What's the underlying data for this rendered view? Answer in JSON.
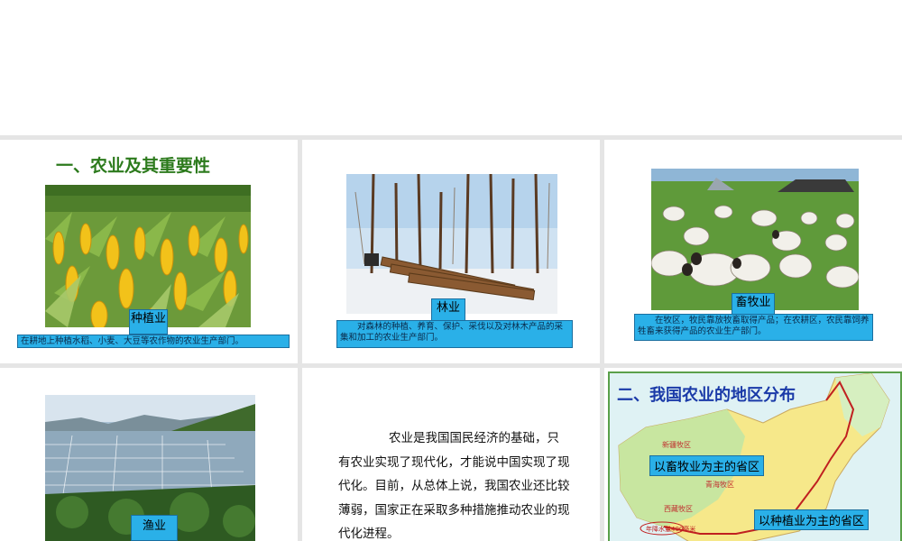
{
  "slide1": {
    "title": "一、农业及其重要性",
    "tag": "种植业",
    "caption": "在耕地上种植水稻、小麦、大豆等农作物的农业生产部门。"
  },
  "slide2": {
    "tag": "林业",
    "caption": "　　对森林的种植、养育、保护、采伐以及对林木产品的采集和加工的农业生产部门。"
  },
  "slide3": {
    "tag": "畜牧业",
    "caption": "　　在牧区，牧民靠放牧畜取得产品；在农耕区，农民靠饲养牲畜来获得产品的农业生产部门。"
  },
  "slide4": {
    "tag": "渔业"
  },
  "slide5": {
    "paragraph": "农业是我国国民经济的基础，只有农业实现了现代化，才能说中国实现了现代化。目前，从总体上说，我国农业还比较薄弱，国家正在采取多种措施推动农业的现代化进程。"
  },
  "slide6": {
    "title": "二、我国农业的地区分布",
    "label_pastoral": "以畜牧业为主的省区",
    "label_planting": "以种植业为主的省区",
    "region_xinjiang": "新疆牧区",
    "region_qinghai": "青海牧区",
    "region_xizang": "西藏牧区",
    "line_note": "年降水量400毫米"
  },
  "colors": {
    "caption_bg": "#2ab0e8",
    "title_green": "#2c7a1c",
    "map_title_blue": "#1a3aa8"
  }
}
